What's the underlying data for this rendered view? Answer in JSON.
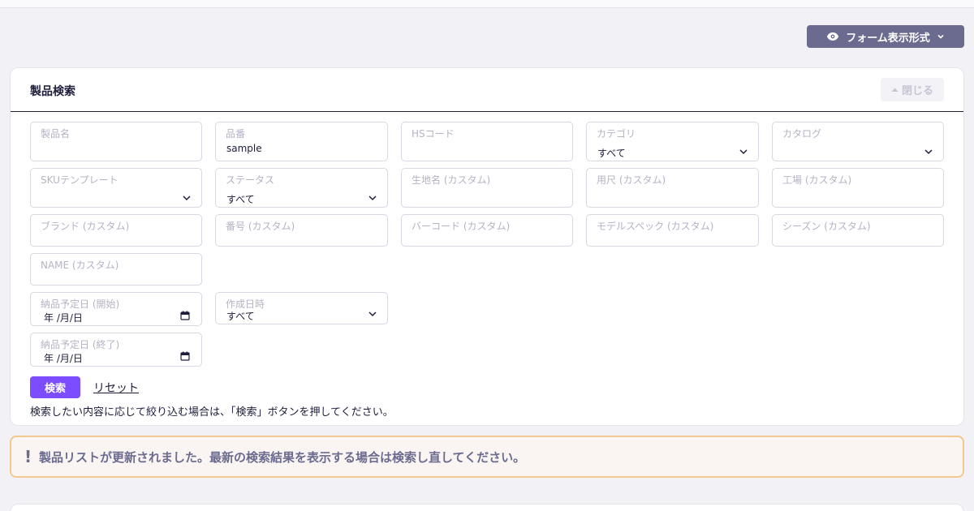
{
  "toolbar": {
    "view_mode_label": "フォーム表示形式"
  },
  "panel": {
    "title": "製品検索",
    "close_label": "閉じる"
  },
  "fields": {
    "product_name": {
      "label": "製品名",
      "value": ""
    },
    "product_number": {
      "label": "品番",
      "value": "sample"
    },
    "hs_code": {
      "label": "HSコード",
      "value": ""
    },
    "category": {
      "label": "カテゴリ",
      "value": "すべて"
    },
    "catalog": {
      "label": "カタログ",
      "value": ""
    },
    "sku_template": {
      "label": "SKUテンプレート",
      "value": ""
    },
    "status": {
      "label": "ステータス",
      "value": "すべて"
    },
    "fabric_name": {
      "label": "生地名 (カスタム)",
      "value": ""
    },
    "fabric_length": {
      "label": "用尺 (カスタム)",
      "value": ""
    },
    "factory": {
      "label": "工場 (カスタム)",
      "value": ""
    },
    "brand": {
      "label": "ブランド (カスタム)",
      "value": ""
    },
    "number": {
      "label": "番号 (カスタム)",
      "value": ""
    },
    "barcode": {
      "label": "バーコード (カスタム)",
      "value": ""
    },
    "model_spec": {
      "label": "モデルスペック (カスタム)",
      "value": ""
    },
    "season": {
      "label": "シーズン (カスタム)",
      "value": ""
    },
    "name_custom": {
      "label": "NAME (カスタム)",
      "value": ""
    },
    "delivery_start": {
      "label": "納品予定日 (開始)",
      "value": "年 /月/日"
    },
    "created_at": {
      "label": "作成日時",
      "value": "すべて"
    },
    "delivery_end": {
      "label": "納品予定日 (終了)",
      "value": "年 /月/日"
    }
  },
  "actions": {
    "search_label": "検索",
    "reset_label": "リセット",
    "hint": "検索したい内容に応じて絞り込む場合は、「検索」ボタンを押してください。"
  },
  "alert": {
    "icon": "!",
    "message": "製品リストが更新されました。最新の検索結果を表示する場合は検索し直してください。"
  },
  "colors": {
    "accent": "#7b4dff",
    "view_button": "#6b6b8f",
    "alert_border": "#f2c98f",
    "alert_bg": "#faf5f2"
  },
  "icons": {
    "view_mode": "eye-icon",
    "close": "caret-up-icon",
    "select": "chevron-down-icon",
    "date": "calendar-icon",
    "alert": "exclamation-icon"
  }
}
